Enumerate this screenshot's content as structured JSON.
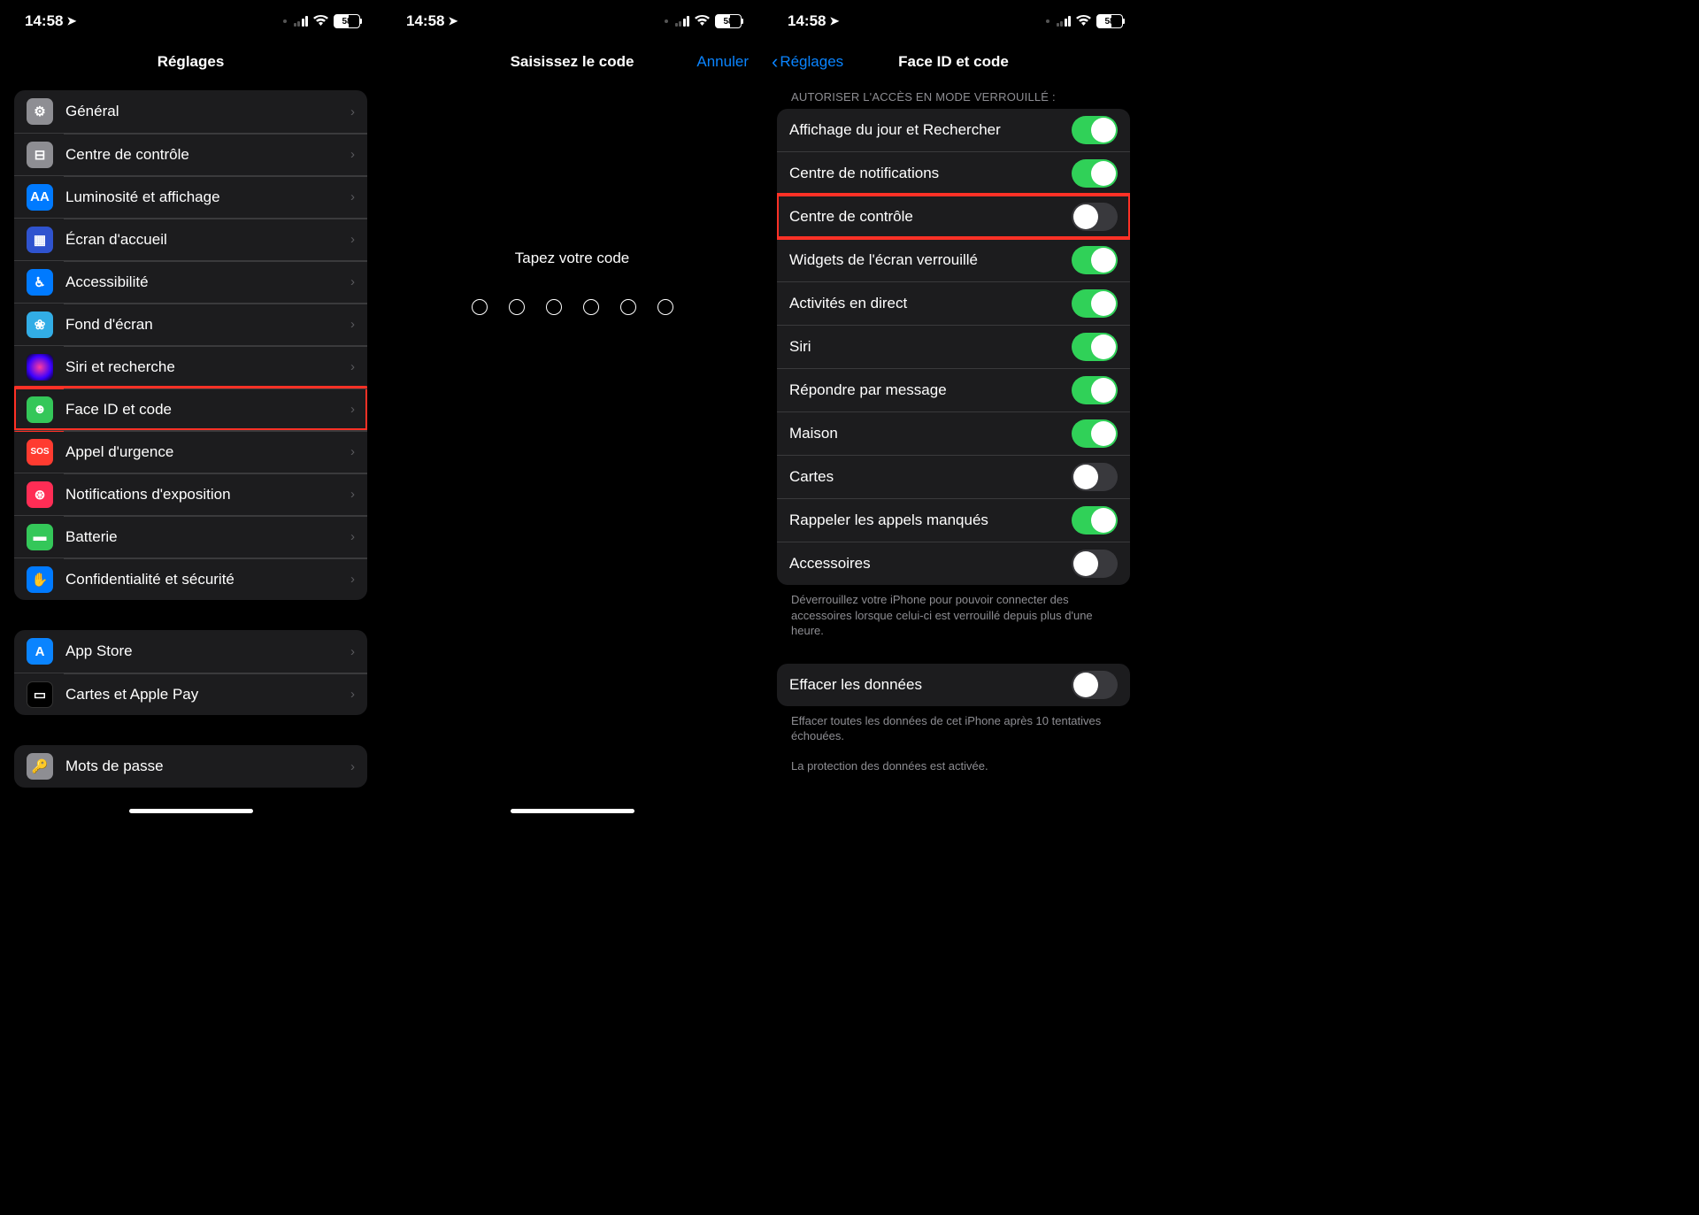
{
  "status": {
    "time": "14:58",
    "battery": "58"
  },
  "screen1": {
    "title": "Réglages",
    "groups": [
      {
        "items": [
          {
            "id": "general",
            "label": "Général",
            "icon": "⚙︎",
            "bg": "ic-gray"
          },
          {
            "id": "control-center",
            "label": "Centre de contrôle",
            "icon": "⊟",
            "bg": "ic-gray2"
          },
          {
            "id": "display",
            "label": "Luminosité et affichage",
            "icon": "AA",
            "bg": "ic-blue"
          },
          {
            "id": "home-screen",
            "label": "Écran d'accueil",
            "icon": "▦",
            "bg": "ic-bluedk"
          },
          {
            "id": "accessibility",
            "label": "Accessibilité",
            "icon": "♿︎",
            "bg": "ic-blue"
          },
          {
            "id": "wallpaper",
            "label": "Fond d'écran",
            "icon": "❀",
            "bg": "ic-cyan"
          },
          {
            "id": "siri",
            "label": "Siri et recherche",
            "icon": "",
            "bg": "ic-siri"
          },
          {
            "id": "faceid",
            "label": "Face ID et code",
            "icon": "☻",
            "bg": "ic-green",
            "highlight": true
          },
          {
            "id": "sos",
            "label": "Appel d'urgence",
            "icon": "SOS",
            "bg": "ic-red"
          },
          {
            "id": "exposure",
            "label": "Notifications d'exposition",
            "icon": "⊛",
            "bg": "ic-pink"
          },
          {
            "id": "battery",
            "label": "Batterie",
            "icon": "▬",
            "bg": "ic-greenb"
          },
          {
            "id": "privacy",
            "label": "Confidentialité et sécurité",
            "icon": "✋",
            "bg": "ic-hand"
          }
        ]
      },
      {
        "items": [
          {
            "id": "app-store",
            "label": "App Store",
            "icon": "A",
            "bg": "ic-as"
          },
          {
            "id": "wallet",
            "label": "Cartes et Apple Pay",
            "icon": "▭",
            "bg": "ic-wallet"
          }
        ]
      },
      {
        "items": [
          {
            "id": "passwords",
            "label": "Mots de passe",
            "icon": "🔑",
            "bg": "ic-key"
          }
        ]
      }
    ]
  },
  "screen2": {
    "title": "Saisissez le code",
    "cancel": "Annuler",
    "prompt": "Tapez votre code",
    "dots": 6
  },
  "screen3": {
    "back": "Réglages",
    "title": "Face ID et code",
    "sectionHeader": "AUTORISER L'ACCÈS EN MODE VERROUILLÉ :",
    "toggles": [
      {
        "id": "today",
        "label": "Affichage du jour et Rechercher",
        "on": true
      },
      {
        "id": "notif",
        "label": "Centre de notifications",
        "on": true
      },
      {
        "id": "cc",
        "label": "Centre de contrôle",
        "on": false,
        "highlight": true
      },
      {
        "id": "widgets",
        "label": "Widgets de l'écran verrouillé",
        "on": true
      },
      {
        "id": "live",
        "label": "Activités en direct",
        "on": true
      },
      {
        "id": "siri",
        "label": "Siri",
        "on": true
      },
      {
        "id": "reply",
        "label": "Répondre par message",
        "on": true
      },
      {
        "id": "home",
        "label": "Maison",
        "on": true
      },
      {
        "id": "wallet2",
        "label": "Cartes",
        "on": false
      },
      {
        "id": "missed",
        "label": "Rappeler les appels manqués",
        "on": true
      },
      {
        "id": "acc",
        "label": "Accessoires",
        "on": false
      }
    ],
    "accFooter": "Déverrouillez votre iPhone pour pouvoir connecter des accessoires lorsque celui-ci est verrouillé depuis plus d'une heure.",
    "erase": {
      "label": "Effacer les données",
      "on": false
    },
    "eraseFooter1": "Effacer toutes les données de cet iPhone après 10 tentatives échouées.",
    "eraseFooter2": "La protection des données est activée."
  }
}
